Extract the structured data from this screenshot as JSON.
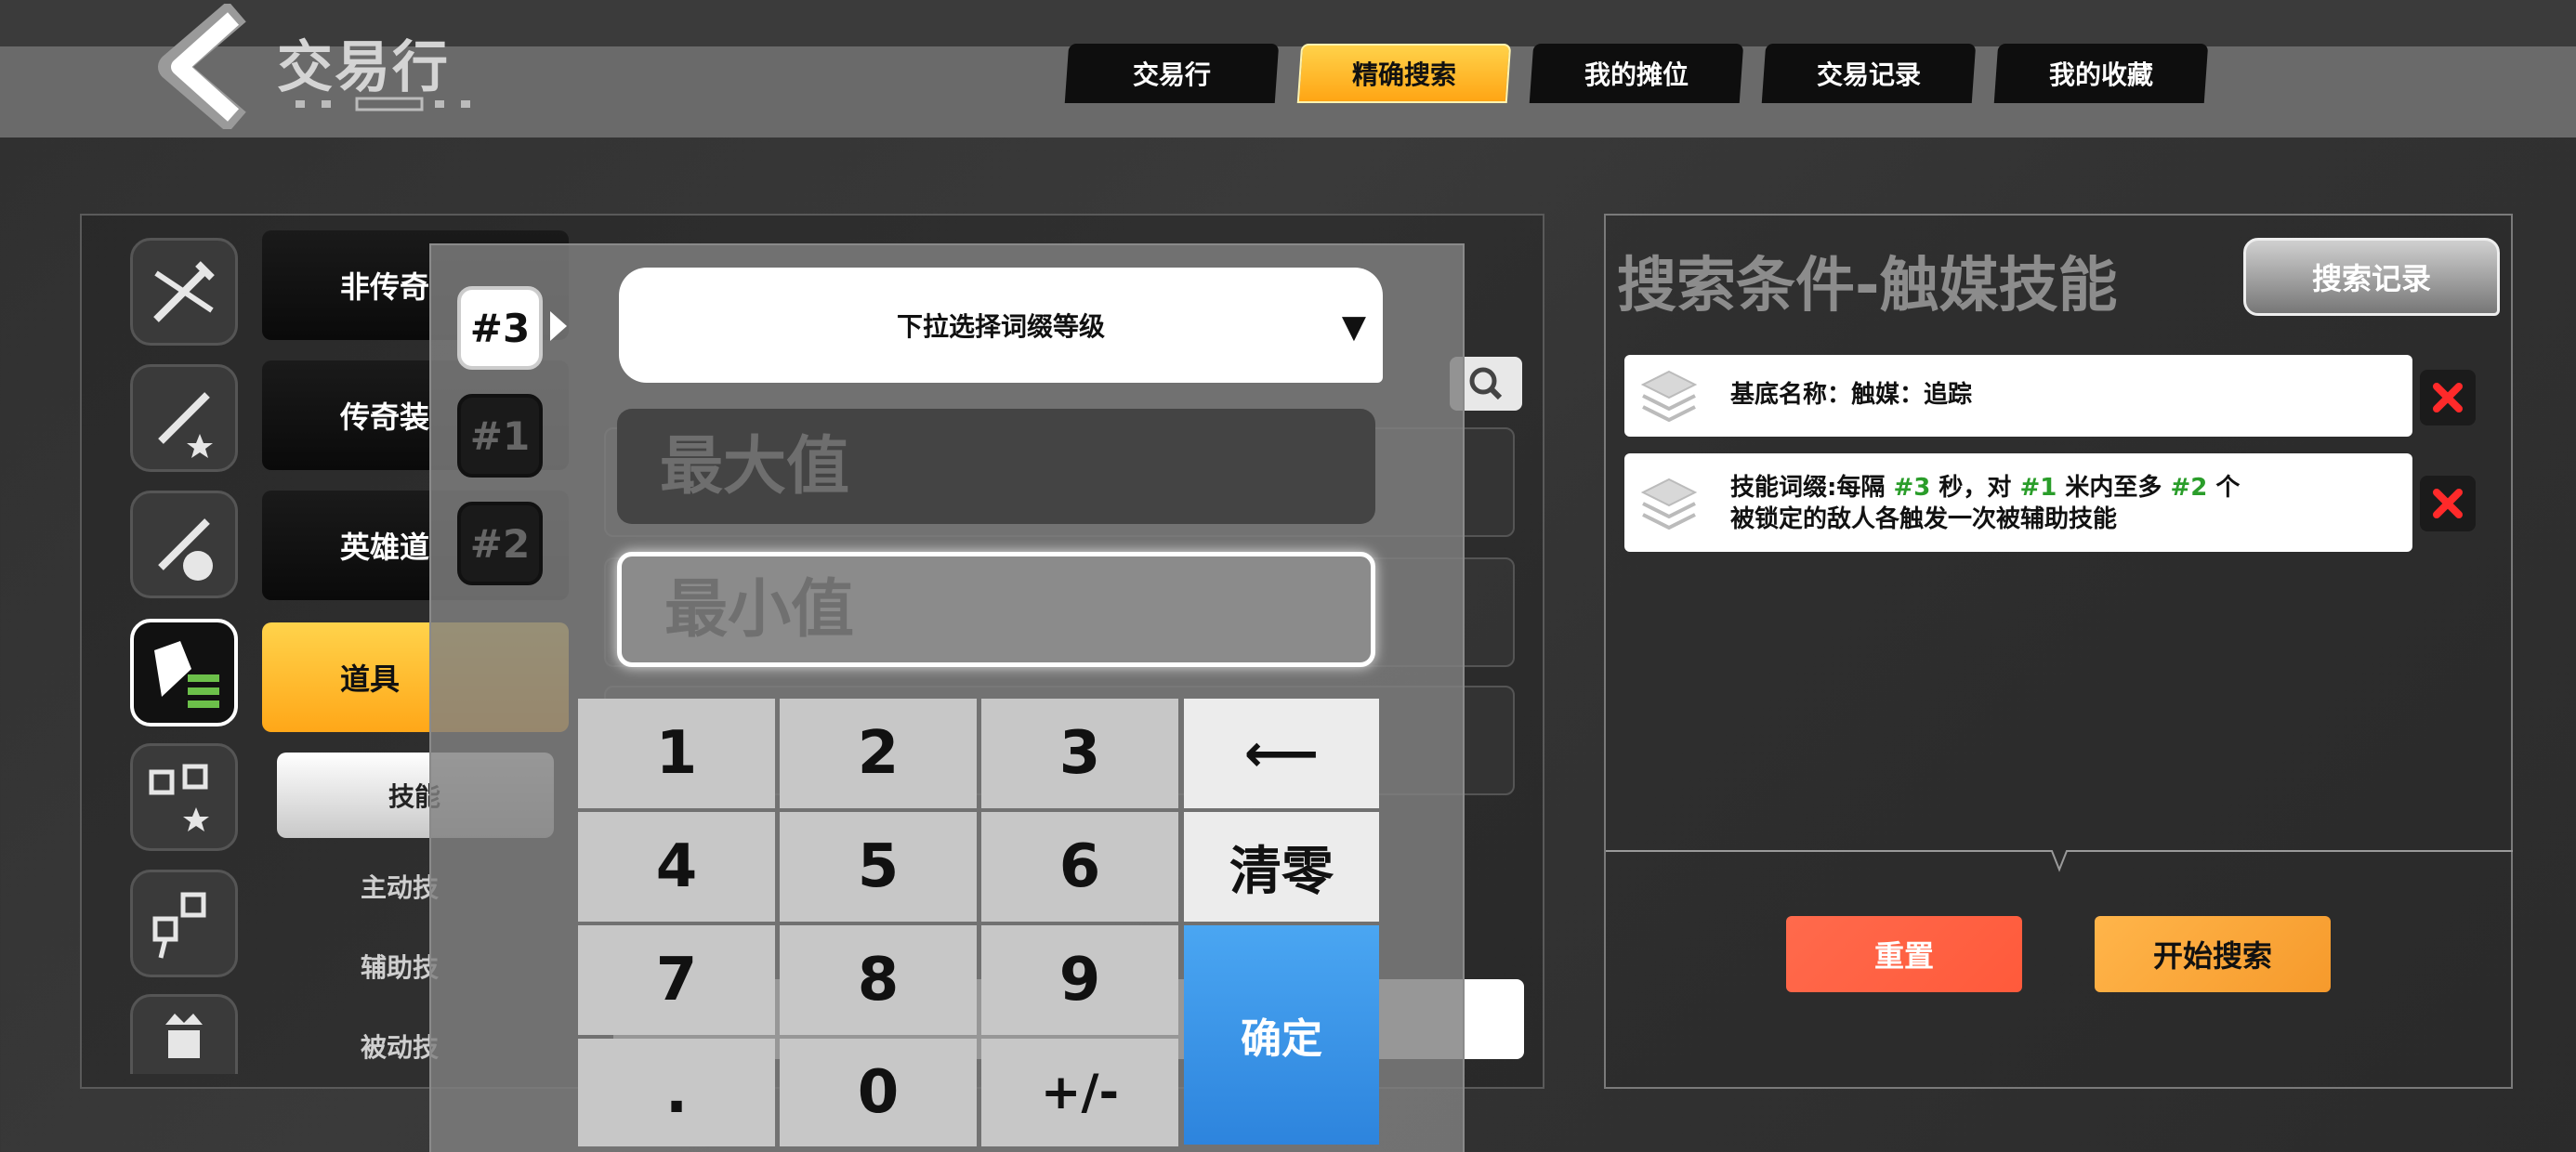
{
  "header": {
    "title": "交易行",
    "tabs": [
      {
        "label": "交易行",
        "active": false
      },
      {
        "label": "精确搜索",
        "active": true
      },
      {
        "label": "我的摊位",
        "active": false
      },
      {
        "label": "交易记录",
        "active": false
      },
      {
        "label": "我的收藏",
        "active": false
      }
    ]
  },
  "sidebar": {
    "categories": [
      {
        "label": "非传奇",
        "icon": "sword-slash-icon"
      },
      {
        "label": "传奇装",
        "icon": "sword-star-icon"
      },
      {
        "label": "英雄道",
        "icon": "helmet-sword-icon"
      },
      {
        "label": "道具",
        "icon": "item-list-icon",
        "active": true
      }
    ],
    "extra_icons": [
      "path-star-icon",
      "path-nodes-icon",
      "crown-figure-icon"
    ],
    "sub_active": "技能",
    "sub_items": [
      "主动技",
      "辅助技",
      "被动技"
    ]
  },
  "numpad": {
    "slots": [
      "#3",
      "#1",
      "#2"
    ],
    "active_slot": "#3",
    "dropdown_label": "下拉选择词缀等级",
    "max_placeholder": "最大值",
    "min_placeholder": "最小值",
    "keys": [
      "1",
      "2",
      "3",
      "4",
      "5",
      "6",
      "7",
      "8",
      "9",
      ".",
      "0",
      "+/-"
    ],
    "backspace": "⟵",
    "clear": "清零",
    "confirm": "确定"
  },
  "conditions": {
    "title": "搜索条件-触媒技能",
    "history_button": "搜索记录",
    "items": [
      {
        "text": "基底名称：触媒：追踪"
      },
      {
        "line1_pre": "技能词缀:每隔 ",
        "v1": "#3",
        "line1_mid1": " 秒，对 ",
        "v2": "#1",
        "line1_mid2": " 米内至多 ",
        "v3": "#2",
        "line1_post": " 个",
        "line2": "被锁定的敌人各触发一次被辅助技能"
      }
    ],
    "reset_button": "重置",
    "search_button": "开始搜索"
  },
  "colors": {
    "accent_gold": "#ffb020",
    "confirm_blue": "#3590e6",
    "reset_red": "#ff5f42",
    "search_orange": "#f8a436",
    "value_green": "#2a9d2a"
  }
}
